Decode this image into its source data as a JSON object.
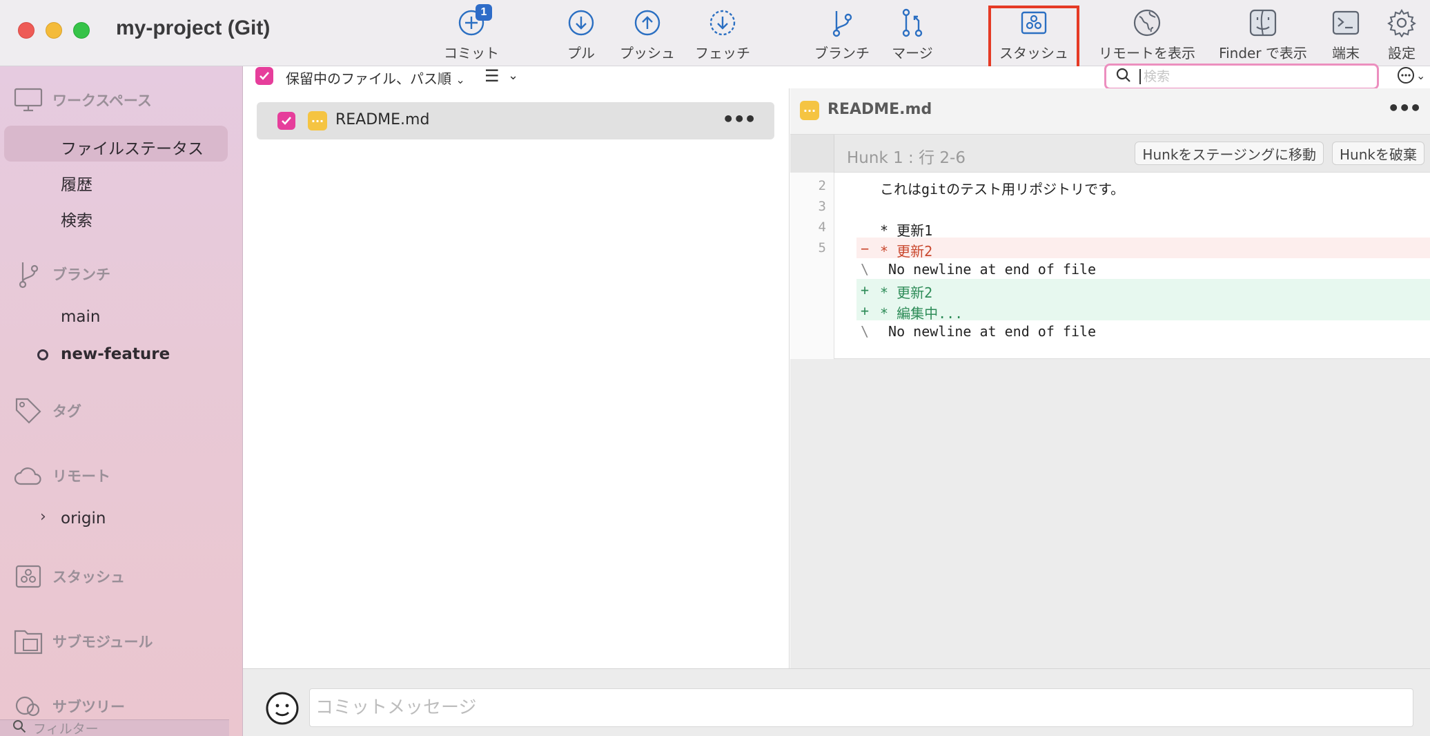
{
  "window": {
    "title": "my-project (Git)"
  },
  "toolbar": {
    "commit": {
      "label": "コミット",
      "badge": "1"
    },
    "pull": "プル",
    "push": "プッシュ",
    "fetch": "フェッチ",
    "branch": "ブランチ",
    "merge": "マージ",
    "stash": "スタッシュ",
    "show_remote": "リモートを表示",
    "show_in_finder": "Finder で表示",
    "terminal": "端末",
    "settings": "設定"
  },
  "sidebar": {
    "workspace": {
      "title": "ワークスペース",
      "items": [
        "ファイルステータス",
        "履歴",
        "検索"
      ]
    },
    "branches": {
      "title": "ブランチ",
      "items": [
        "main",
        "new-feature"
      ],
      "current": "new-feature"
    },
    "tags": {
      "title": "タグ"
    },
    "remotes": {
      "title": "リモート",
      "items": [
        "origin"
      ]
    },
    "stashes": {
      "title": "スタッシュ"
    },
    "submodules": {
      "title": "サブモジュール"
    },
    "subtrees": {
      "title": "サブツリー"
    },
    "filter_placeholder": "フィルター"
  },
  "file_list": {
    "sort_label": "保留中のファイル、パス順",
    "files": [
      {
        "name": "README.md",
        "staged": true,
        "status": "modified"
      }
    ]
  },
  "search": {
    "placeholder": "検索"
  },
  "diff": {
    "file": "README.md",
    "hunk_title": "Hunk 1 : 行 2-6",
    "stage_hunk": "Hunkをステージングに移動",
    "discard_hunk": "Hunkを破棄",
    "lines": [
      {
        "num": "2",
        "marker": "",
        "text": "これはgitのテスト用リポジトリです。",
        "kind": "ctx"
      },
      {
        "num": "3",
        "marker": "",
        "text": "",
        "kind": "ctx"
      },
      {
        "num": "4",
        "marker": "",
        "text": "* 更新1",
        "kind": "ctx"
      },
      {
        "num": "5",
        "marker": "−",
        "text": "* 更新2",
        "kind": "del"
      },
      {
        "num": "",
        "marker": "\\",
        "text": " No newline at end of file",
        "kind": "note"
      },
      {
        "num": "",
        "marker": "+",
        "text": "* 更新2",
        "kind": "add"
      },
      {
        "num": "",
        "marker": "+",
        "text": "* 編集中...",
        "kind": "add"
      },
      {
        "num": "",
        "marker": "\\",
        "text": " No newline at end of file",
        "kind": "note"
      }
    ]
  },
  "commit": {
    "placeholder": "コミットメッセージ"
  },
  "colors": {
    "accent_pink": "#e63e9b",
    "stash_highlight": "#e53a25",
    "toolbar_icon": "#2b6fc2",
    "modified_badge": "#f5c442"
  }
}
